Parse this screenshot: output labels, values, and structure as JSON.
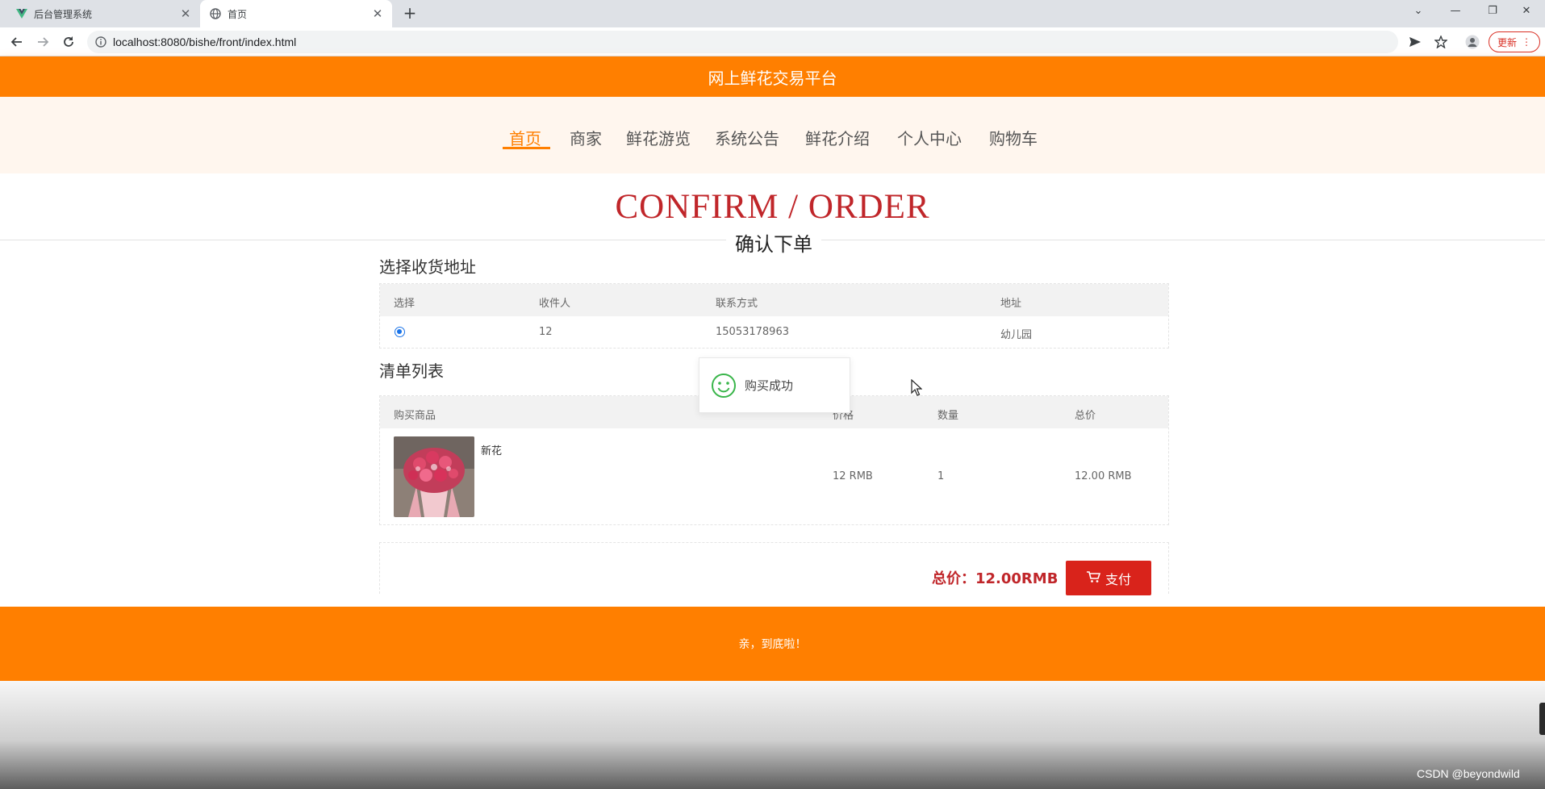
{
  "browser": {
    "tabs": [
      {
        "title": "后台管理系统",
        "favicon": "vue-logo-icon"
      },
      {
        "title": "首页",
        "favicon": "globe-icon"
      }
    ],
    "new_tab": "+",
    "url": "localhost:8080/bishe/front/index.html",
    "update_label": "更新"
  },
  "site": {
    "title": "网上鲜花交易平台",
    "nav": [
      "首页",
      "商家",
      "鲜花游览",
      "系统公告",
      "鲜花介绍",
      "个人中心",
      "购物车"
    ],
    "active_nav": "首页",
    "accent": "#ff7f00"
  },
  "page": {
    "heading_en": "CONFIRM / ORDER",
    "heading_cn": "确认下单"
  },
  "address": {
    "section_title": "选择收货地址",
    "headers": [
      "选择",
      "收件人",
      "联系方式",
      "地址"
    ],
    "rows": [
      {
        "selected": true,
        "recipient": "12",
        "phone": "15053178963",
        "address": "幼儿园"
      }
    ]
  },
  "items": {
    "section_title": "清单列表",
    "headers": [
      "购买商品",
      "价格",
      "数量",
      "总价"
    ],
    "rows": [
      {
        "name": "新花",
        "price": "12 RMB",
        "qty": "1",
        "total": "12.00 RMB",
        "image": "flower-bouquet-image"
      }
    ]
  },
  "summary": {
    "total_label": "总价：12.00RMB",
    "pay_label": "支付",
    "pay_color": "#d9231b"
  },
  "toast": {
    "text": "购买成功",
    "icon": "smile-icon"
  },
  "footer": {
    "text": "亲，到底啦！"
  },
  "watermark": "CSDN @beyondwild"
}
